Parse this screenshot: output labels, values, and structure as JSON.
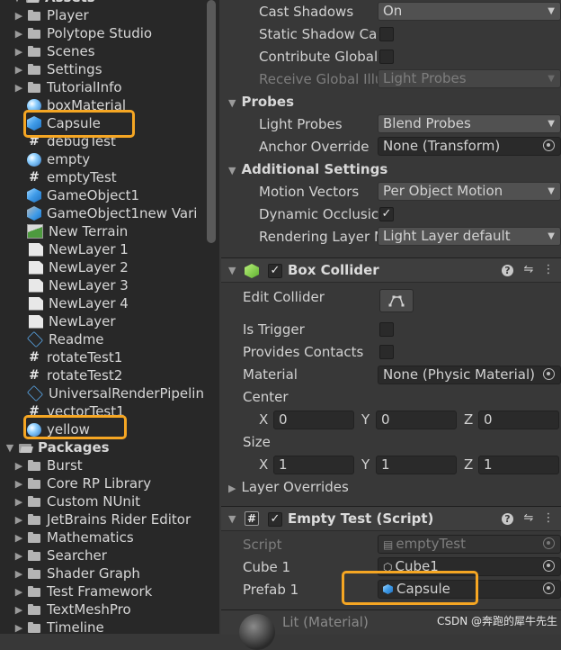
{
  "project": {
    "top_partial": "Assets",
    "items": [
      {
        "label": "Player",
        "icon": "folder-icon"
      },
      {
        "label": "Polytope Studio",
        "icon": "folder-icon"
      },
      {
        "label": "Scenes",
        "icon": "folder-icon"
      },
      {
        "label": "Settings",
        "icon": "folder-icon"
      },
      {
        "label": "TutorialInfo",
        "icon": "folder-icon"
      },
      {
        "label": "boxMaterial",
        "icon": "material-sphere-icon"
      },
      {
        "label": "Capsule",
        "icon": "prefab-cube-icon"
      },
      {
        "label": "debugTest",
        "icon": "script-icon"
      },
      {
        "label": "empty",
        "icon": "material-sphere-icon"
      },
      {
        "label": "emptyTest",
        "icon": "script-icon"
      },
      {
        "label": "GameObject1",
        "icon": "prefab-cube-icon"
      },
      {
        "label": "GameObject1new Vari",
        "icon": "prefab-variant-icon"
      },
      {
        "label": "New Terrain",
        "icon": "terrain-icon"
      },
      {
        "label": "NewLayer 1",
        "icon": "document-icon"
      },
      {
        "label": "NewLayer 2",
        "icon": "document-icon"
      },
      {
        "label": "NewLayer 3",
        "icon": "document-icon"
      },
      {
        "label": "NewLayer 4",
        "icon": "document-icon"
      },
      {
        "label": "NewLayer",
        "icon": "document-icon"
      },
      {
        "label": "Readme",
        "icon": "scriptable-object-icon"
      },
      {
        "label": "rotateTest1",
        "icon": "script-icon"
      },
      {
        "label": "rotateTest2",
        "icon": "script-icon"
      },
      {
        "label": "UniversalRenderPipelin",
        "icon": "scriptable-object-icon"
      },
      {
        "label": "vectorTest1",
        "icon": "script-icon"
      },
      {
        "label": "yellow",
        "icon": "material-sphere-icon"
      }
    ],
    "packages_label": "Packages",
    "packages": [
      "Burst",
      "Core RP Library",
      "Custom NUnit",
      "JetBrains Rider Editor",
      "Mathematics",
      "Searcher",
      "Shader Graph",
      "Test Framework",
      "TextMeshPro",
      "Timeline"
    ]
  },
  "inspector": {
    "lighting": {
      "cast_shadows_label": "Cast Shadows",
      "cast_shadows_value": "On",
      "static_shadow_label": "Static Shadow Ca",
      "contribute_gi_label": "Contribute Global",
      "receive_gi_label": "Receive Global Illu",
      "receive_gi_value": "Light Probes"
    },
    "probes": {
      "title": "Probes",
      "light_probes_label": "Light Probes",
      "light_probes_value": "Blend Probes",
      "anchor_label": "Anchor Override",
      "anchor_value": "None (Transform)"
    },
    "additional": {
      "title": "Additional Settings",
      "motion_label": "Motion Vectors",
      "motion_value": "Per Object Motion",
      "dynamic_label": "Dynamic Occlusic",
      "rendering_layer_label": "Rendering Layer M",
      "rendering_layer_value": "Light Layer default"
    },
    "box_collider": {
      "title": "Box Collider",
      "edit_label": "Edit Collider",
      "trigger_label": "Is Trigger",
      "contacts_label": "Provides Contacts",
      "material_label": "Material",
      "material_value": "None (Physic Material)",
      "center_label": "Center",
      "center": {
        "x": "0",
        "y": "0",
        "z": "0"
      },
      "size_label": "Size",
      "size": {
        "x": "1",
        "y": "1",
        "z": "1"
      },
      "layer_overrides_label": "Layer Overrides",
      "axis_x": "X",
      "axis_y": "Y",
      "axis_z": "Z"
    },
    "empty_test": {
      "title": "Empty Test (Script)",
      "script_label": "Script",
      "script_value": "emptyTest",
      "cube_label": "Cube 1",
      "cube_value": "Cube1",
      "prefab_label": "Prefab 1",
      "prefab_value": "Capsule"
    },
    "material_footer": "Lit (Material)"
  },
  "watermark": "CSDN @奔跑的犀牛先生",
  "colors": {
    "highlight": "#f5a623",
    "panel": "#282828",
    "inspector": "#383838"
  }
}
